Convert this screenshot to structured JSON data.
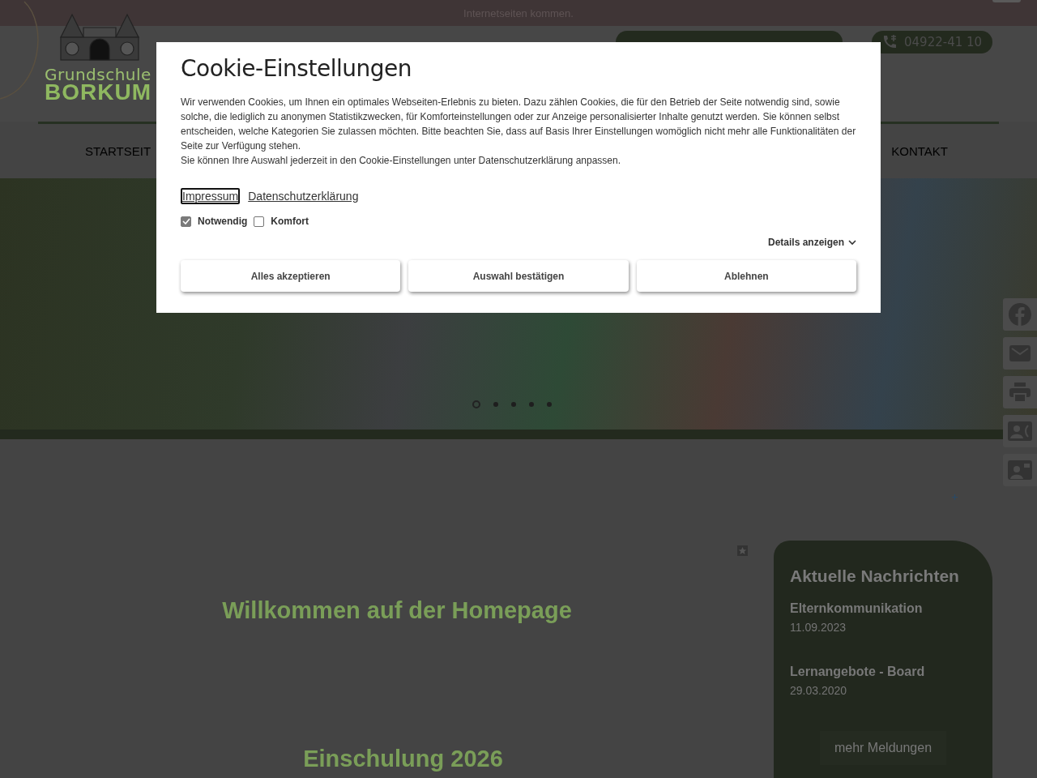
{
  "notice_bar": {
    "text": "Internetseiten kommen."
  },
  "header": {
    "logo_line_1": "Grundschule",
    "logo_line_2": "BORKUM",
    "phone": "04922-41 10"
  },
  "nav": {
    "items": [
      {
        "label": "STARTSEIT"
      },
      {
        "label": "KONTAKT"
      }
    ]
  },
  "hero": {
    "slides": [
      {
        "selected": true
      },
      {
        "selected": false
      },
      {
        "selected": false
      },
      {
        "selected": false
      },
      {
        "selected": false
      }
    ]
  },
  "main": {
    "headings": [
      "Willkommen auf der Homepage",
      "Einschulung 2026"
    ]
  },
  "news": {
    "title": "Aktuelle Nachrichten",
    "items": [
      {
        "title": "Elternkommunikation",
        "date": "11.09.2023"
      },
      {
        "title": "Lernangebote - Board",
        "date": "29.03.2020"
      }
    ],
    "more": "mehr Meldungen"
  },
  "cookie_dialog": {
    "title": "Cookie-Einstellungen",
    "paragraphs": [
      "Wir verwenden Cookies, um Ihnen ein optimales Webseiten-Erlebnis zu bieten. Dazu zählen Cookies, die für den Betrieb der Seite notwendig sind, sowie solche, die lediglich zu anonymen Statistikzwecken, für Komforteinstellungen oder zur Anzeige personalisierter Inhalte genutzt werden. Sie können selbst entscheiden, welche Kategorien Sie zulassen möchten. Bitte beachten Sie, dass auf Basis Ihrer Einstellungen womöglich nicht mehr alle Funktionalitäten der Seite zur Verfügung stehen.",
      "Sie können Ihre Auswahl jederzeit in den Cookie-Einstellungen unter Datenschutzerklärung anpassen."
    ],
    "links": [
      {
        "label": "Impressum",
        "focused": true
      },
      {
        "label": "Datenschutzerklärung",
        "focused": false
      }
    ],
    "options": [
      {
        "label": "Notwendig",
        "checked": true,
        "disabled": true
      },
      {
        "label": "Komfort",
        "checked": false,
        "disabled": false
      }
    ],
    "details_toggle": "Details anzeigen",
    "buttons": [
      "Alles akzeptieren",
      "Auswahl bestätigen",
      "Ablehnen"
    ]
  }
}
